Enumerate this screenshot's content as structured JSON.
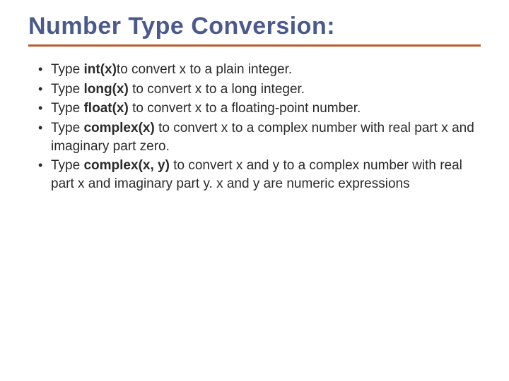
{
  "title": "Number Type Conversion:",
  "bullets": [
    {
      "pre": "Type ",
      "fn": "int(x)",
      "post": "to convert x to a plain integer."
    },
    {
      "pre": "Type ",
      "fn": "long(x)",
      "post": " to convert x to a long integer."
    },
    {
      "pre": "Type ",
      "fn": "float(x)",
      "post": " to convert x to a floating-point number."
    },
    {
      "pre": "Type ",
      "fn": "complex(x)",
      "post": " to convert x to a complex number with real part x and imaginary part zero."
    },
    {
      "pre": "Type ",
      "fn": "complex(x, y)",
      "post": " to convert x and y to a complex number with real part x and imaginary part y. x and y are numeric expressions"
    }
  ]
}
